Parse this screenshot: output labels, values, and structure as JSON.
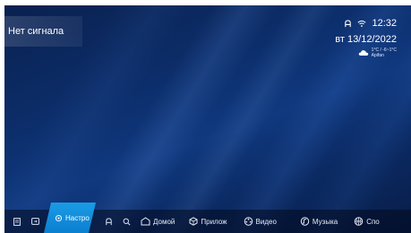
{
  "screen": {
    "no_signal": "Нет сигнала"
  },
  "status": {
    "time": "12:32",
    "date": "вт 13/12/2022",
    "weather_temp": "1°C / -6~1°C",
    "weather_city": "Apifan"
  },
  "bottom_bar": {
    "active_tab_label": "Настро",
    "items": [
      {
        "label": "Домой",
        "icon": "home-icon"
      },
      {
        "label": "Прилож",
        "icon": "apps-icon"
      },
      {
        "label": "Видео",
        "icon": "video-icon"
      },
      {
        "label": "Музыка",
        "icon": "music-icon"
      },
      {
        "label": "Спо",
        "icon": "sports-icon"
      }
    ]
  },
  "colors": {
    "accent": "#1a9be6",
    "background": "#0c2e6b"
  }
}
